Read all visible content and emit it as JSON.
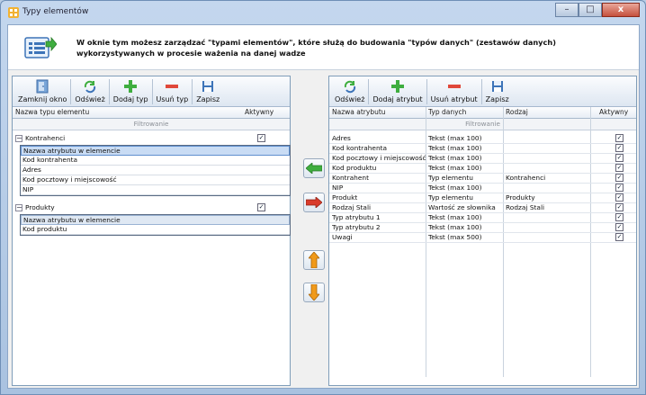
{
  "window": {
    "title": "Typy elementów"
  },
  "header": {
    "text": "W oknie tym możesz zarządzać \"typami elementów\", które służą do budowania \"typów danych\" (zestawów danych) wykorzystywanych w procesie ważenia na danej wadze"
  },
  "left_toolbar": {
    "close": "Zamknij okno",
    "refresh": "Odśwież",
    "add": "Dodaj typ",
    "remove": "Usuń typ",
    "save": "Zapisz"
  },
  "left_grid": {
    "col_name": "Nazwa typu elementu",
    "col_active": "Aktywny",
    "filter": "Filtrowanie",
    "groups": [
      {
        "name": "Kontrahenci",
        "checked": true,
        "sub_header": "Nazwa atrybutu w elemencie",
        "attrs": [
          "Kod kontrahenta",
          "Adres",
          "Kod pocztowy i miejscowość",
          "NIP"
        ]
      },
      {
        "name": "Produkty",
        "checked": true,
        "sub_header": "Nazwa atrybutu w elemencie",
        "attrs": [
          "Kod produktu"
        ]
      }
    ]
  },
  "right_toolbar": {
    "refresh": "Odśwież",
    "add": "Dodaj atrybut",
    "remove": "Usuń atrybut",
    "save": "Zapisz"
  },
  "right_grid": {
    "col_name": "Nazwa atrybutu",
    "col_type": "Typ danych",
    "col_kind": "Rodzaj",
    "col_active": "Aktywny",
    "filter": "Filtrowanie",
    "rows": [
      {
        "name": "Adres",
        "type": "Tekst (max 100)",
        "kind": ""
      },
      {
        "name": "Kod kontrahenta",
        "type": "Tekst (max 100)",
        "kind": ""
      },
      {
        "name": "Kod pocztowy i miejscowość",
        "type": "Tekst (max 100)",
        "kind": ""
      },
      {
        "name": "Kod produktu",
        "type": "Tekst (max 100)",
        "kind": ""
      },
      {
        "name": "Kontrahent",
        "type": "Typ elementu",
        "kind": "Kontrahenci"
      },
      {
        "name": "NIP",
        "type": "Tekst (max 100)",
        "kind": ""
      },
      {
        "name": "Produkt",
        "type": "Typ elementu",
        "kind": "Produkty"
      },
      {
        "name": "Rodzaj Stali",
        "type": "Wartość ze słownika",
        "kind": "Rodzaj Stali"
      },
      {
        "name": "Typ atrybutu 1",
        "type": "Tekst (max 100)",
        "kind": ""
      },
      {
        "name": "Typ atrybutu 2",
        "type": "Tekst (max 100)",
        "kind": ""
      },
      {
        "name": "Uwagi",
        "type": "Tekst (max 500)",
        "kind": ""
      }
    ]
  },
  "colors": {
    "accent_green": "#3fae3f",
    "accent_red": "#d93b2b",
    "accent_orange": "#f09a1a",
    "selection": "#c9dcf4"
  }
}
